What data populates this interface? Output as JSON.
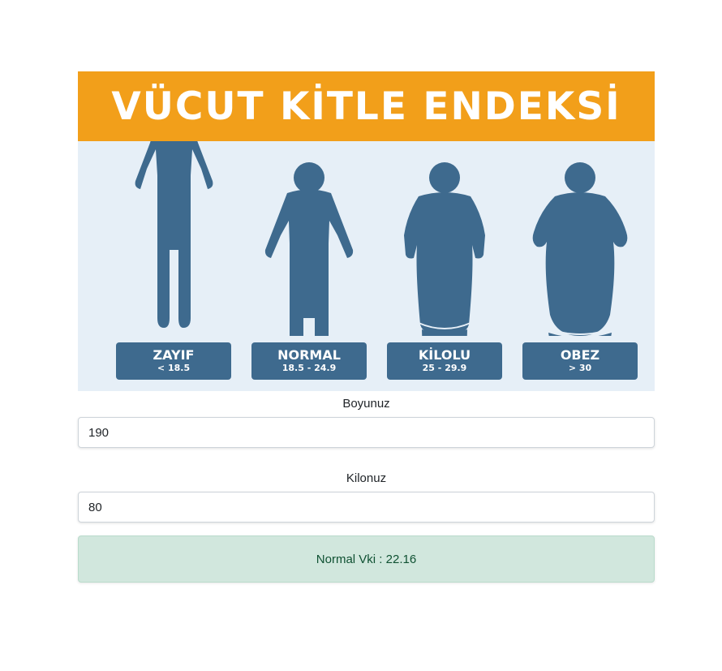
{
  "banner": {
    "title": "VÜCUT KİTLE ENDEKSİ",
    "categories": [
      {
        "name": "ZAYIF",
        "range": "< 18.5"
      },
      {
        "name": "NORMAL",
        "range": "18.5 - 24.9"
      },
      {
        "name": "KİLOLU",
        "range": "25 - 29.9"
      },
      {
        "name": "OBEZ",
        "range": "> 30"
      }
    ]
  },
  "form": {
    "height_label": "Boyunuz",
    "height_value": "190",
    "weight_label": "Kilonuz",
    "weight_value": "80"
  },
  "result": {
    "text": "Normal Vki : 22.16"
  },
  "colors": {
    "banner_header": "#f29f1a",
    "figure": "#3e6a8e",
    "banner_bg": "#e6eff7",
    "result_bg": "#d1e7dd",
    "result_text": "#0f5132"
  }
}
